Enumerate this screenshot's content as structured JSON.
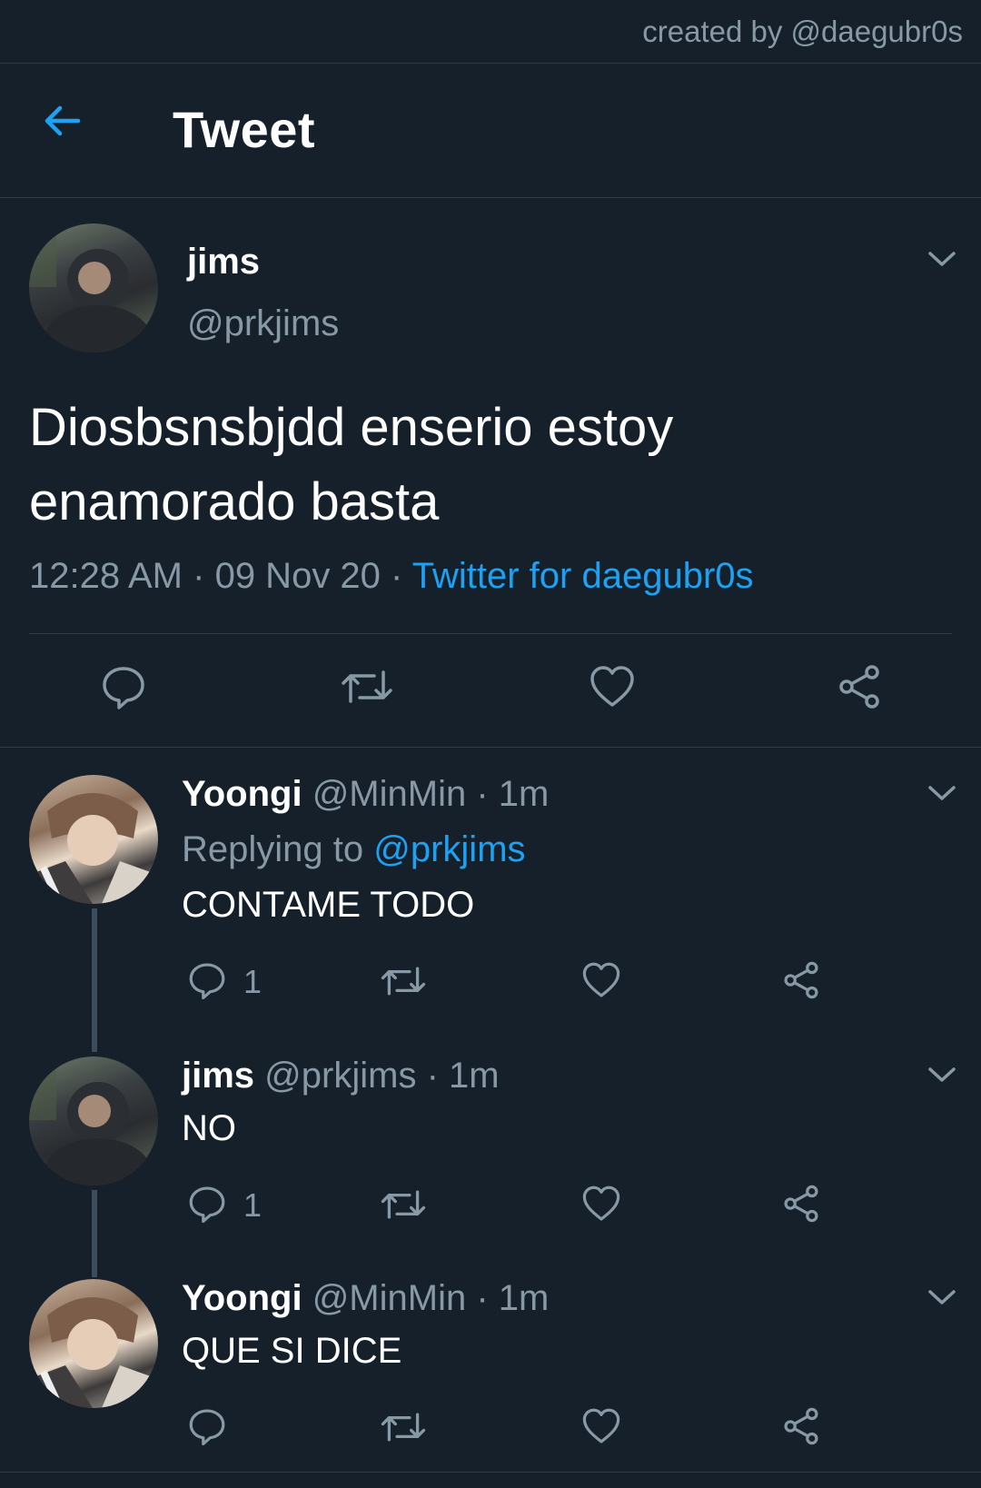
{
  "watermark": "created by @daegubr0s",
  "header": {
    "title": "Tweet"
  },
  "tweet": {
    "name": "jims",
    "handle": "@prkjims",
    "text": "Diosbsnsbjdd enserio estoy enamorado basta",
    "time": "12:28 AM",
    "date": "09 Nov 20",
    "source": "Twitter for daegubr0s"
  },
  "replies": [
    {
      "name": "Yoongi",
      "handle": "@MinMin",
      "age": "1m",
      "replying_label": "Replying to",
      "replying_to": "@prkjims",
      "text": "CONTAME TODO",
      "reply_count": "1"
    },
    {
      "name": "jims",
      "handle": "@prkjims",
      "age": "1m",
      "text": "NO",
      "reply_count": "1"
    },
    {
      "name": "Yoongi",
      "handle": "@MinMin",
      "age": "1m",
      "text": "QUE SI DICE"
    }
  ],
  "colors": {
    "background": "#15202b",
    "accent": "#1da1f2",
    "secondary_text": "#8899a6",
    "divider": "#2f3b47"
  },
  "icons": [
    "back-arrow-icon",
    "chevron-down-icon",
    "reply-icon",
    "retweet-icon",
    "like-icon",
    "share-icon"
  ]
}
